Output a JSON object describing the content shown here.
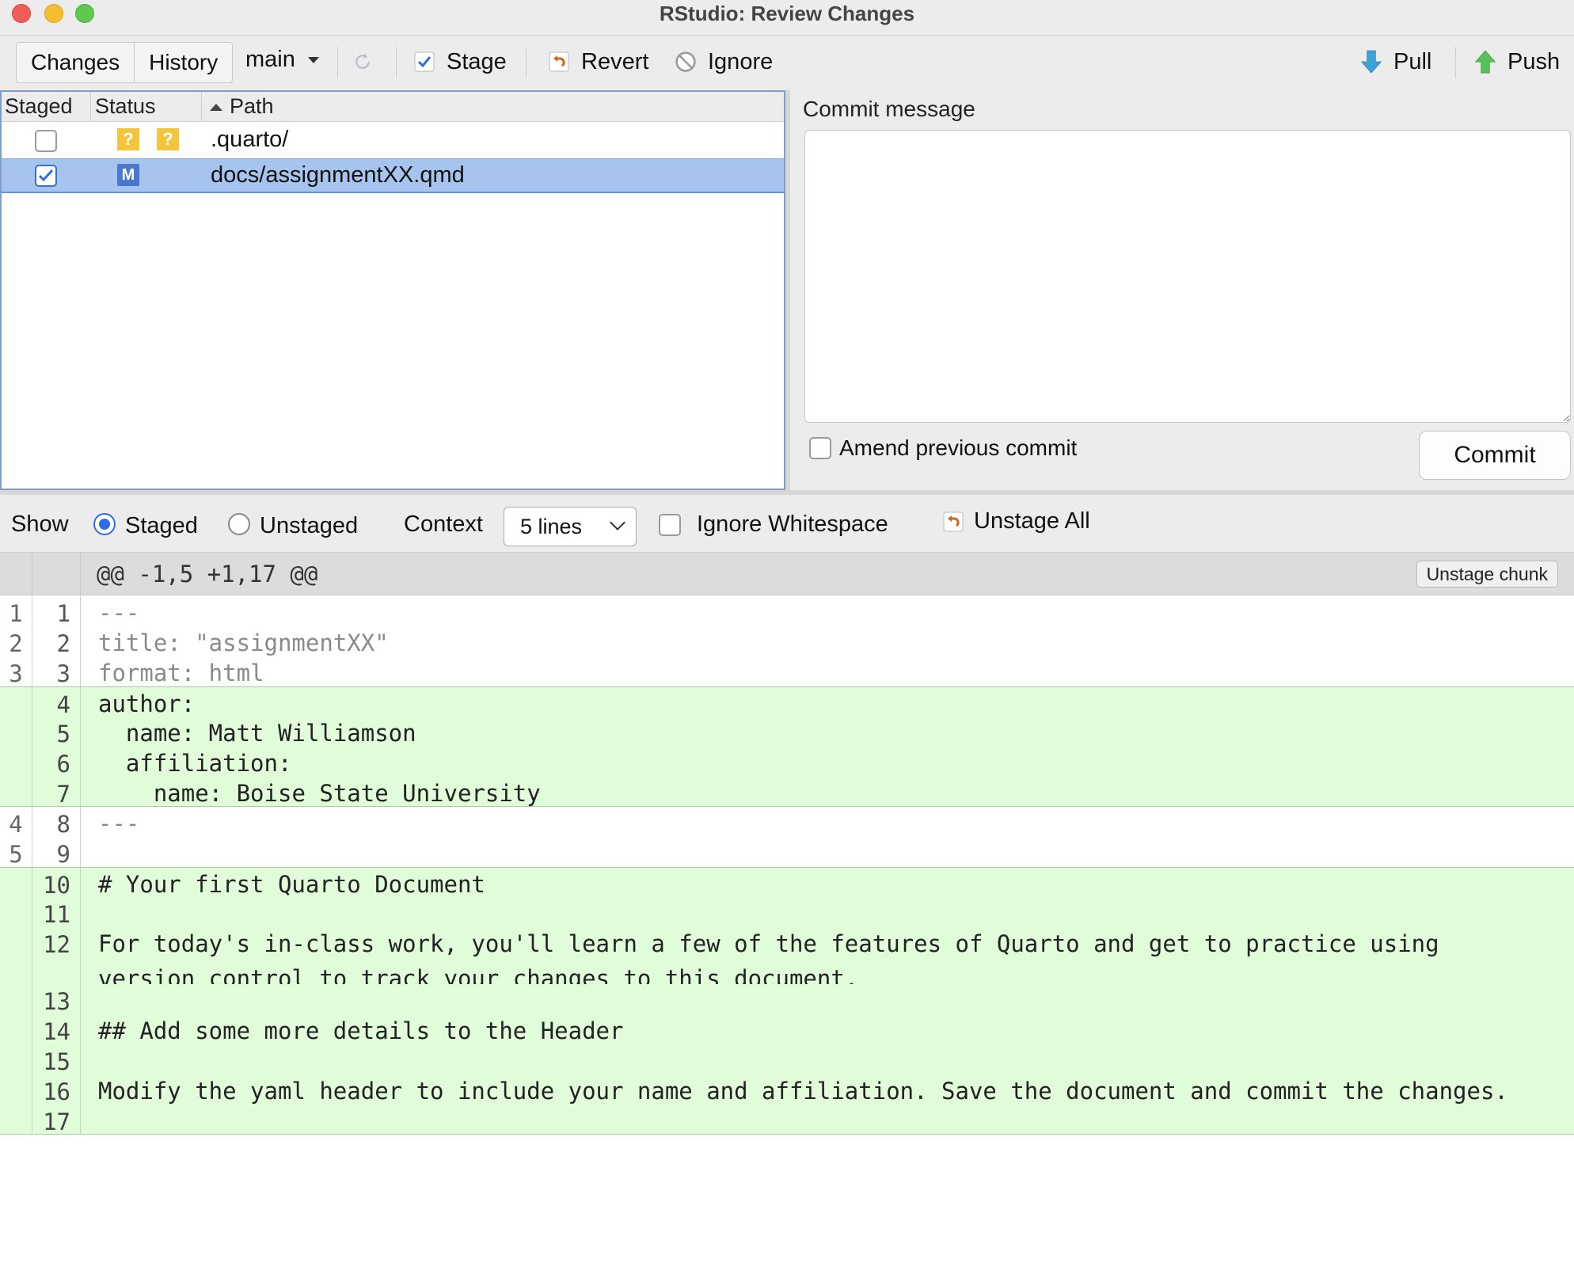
{
  "window": {
    "title": "RStudio: Review Changes"
  },
  "toolbar": {
    "tabs": [
      "Changes",
      "History"
    ],
    "branch": "main",
    "stage_label": "Stage",
    "revert_label": "Revert",
    "ignore_label": "Ignore",
    "pull_label": "Pull",
    "push_label": "Push"
  },
  "files": {
    "columns": [
      "Staged",
      "Status",
      "Path"
    ],
    "rows": [
      {
        "staged": false,
        "status": [
          "?",
          "?"
        ],
        "path": ".quarto/"
      },
      {
        "staged": true,
        "status": [
          "M"
        ],
        "path": "docs/assignmentXX.qmd",
        "selected": true
      }
    ]
  },
  "commit": {
    "label": "Commit message",
    "message": "",
    "amend_label": "Amend previous commit",
    "amend_checked": false,
    "button_label": "Commit"
  },
  "diff_options": {
    "show_label": "Show",
    "staged_label": "Staged",
    "unstaged_label": "Unstaged",
    "show_selected": "Staged",
    "context_label": "Context",
    "context_value": "5 lines",
    "ignore_ws_label": "Ignore Whitespace",
    "unstage_all_label": "Unstage All"
  },
  "diff": {
    "hunk_header": "@@ -1,5 +1,17 @@",
    "unstage_chunk_label": "Unstage chunk",
    "lines": [
      {
        "old": "1",
        "new": "1",
        "type": "ctx",
        "text": "---"
      },
      {
        "old": "2",
        "new": "2",
        "type": "ctx",
        "text": "title: \"assignmentXX\""
      },
      {
        "old": "3",
        "new": "3",
        "type": "ctx",
        "text": "format: html"
      },
      {
        "old": "",
        "new": "4",
        "type": "add",
        "text": "author:"
      },
      {
        "old": "",
        "new": "5",
        "type": "add",
        "text": "  name: Matt Williamson"
      },
      {
        "old": "",
        "new": "6",
        "type": "add",
        "text": "  affiliation:"
      },
      {
        "old": "",
        "new": "7",
        "type": "add",
        "text": "    name: Boise State University"
      },
      {
        "old": "4",
        "new": "8",
        "type": "ctx",
        "text": "---"
      },
      {
        "old": "5",
        "new": "9",
        "type": "ctx",
        "text": ""
      },
      {
        "old": "",
        "new": "10",
        "type": "add",
        "text": "# Your first Quarto Document"
      },
      {
        "old": "",
        "new": "11",
        "type": "add",
        "text": ""
      },
      {
        "old": "",
        "new": "12",
        "type": "add",
        "text": "For today's in-class work, you'll learn a few of the features of Quarto and get to practice using version control to track your changes to this document."
      },
      {
        "old": "",
        "new": "13",
        "type": "add",
        "text": ""
      },
      {
        "old": "",
        "new": "14",
        "type": "add",
        "text": "## Add some more details to the Header"
      },
      {
        "old": "",
        "new": "15",
        "type": "add",
        "text": ""
      },
      {
        "old": "",
        "new": "16",
        "type": "add",
        "text": "Modify the yaml header to include your name and affiliation. Save the document and commit the changes."
      },
      {
        "old": "",
        "new": "17",
        "type": "add",
        "text": ""
      }
    ]
  },
  "colors": {
    "added_line_bg": "#e1fcd8",
    "selection_bg": "#a6c4ed",
    "status_untracked": "#f3c53d",
    "status_modified": "#4b78cf"
  }
}
